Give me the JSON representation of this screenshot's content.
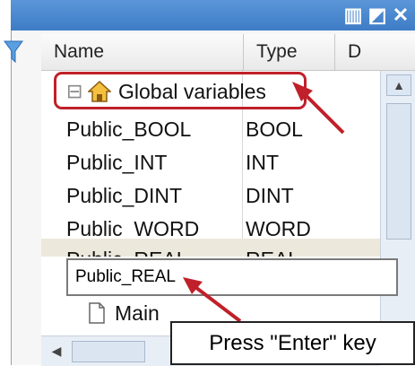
{
  "header": {
    "name_label": "Name",
    "type_label": "Type",
    "third_label": "D"
  },
  "tree": {
    "group_label": "Global variables",
    "expand_symbol": "⊟",
    "rows": [
      {
        "name": "Public_BOOL",
        "type": "BOOL"
      },
      {
        "name": "Public_INT",
        "type": "INT"
      },
      {
        "name": "Public_DINT",
        "type": "DINT"
      },
      {
        "name": "Public_WORD",
        "type": "WORD"
      },
      {
        "name": "Public_REAL",
        "type": "REAL"
      }
    ],
    "main_label": "Main"
  },
  "edit": {
    "value": "Public_REAL"
  },
  "annotation": {
    "text": "Press \"Enter\" key"
  },
  "icons": {
    "filter": "filter-icon",
    "home": "home-icon",
    "document": "document-icon"
  },
  "colors": {
    "title_bar": "#4a88d0",
    "highlight_border": "#c0202a",
    "arrow": "#c0202a"
  }
}
